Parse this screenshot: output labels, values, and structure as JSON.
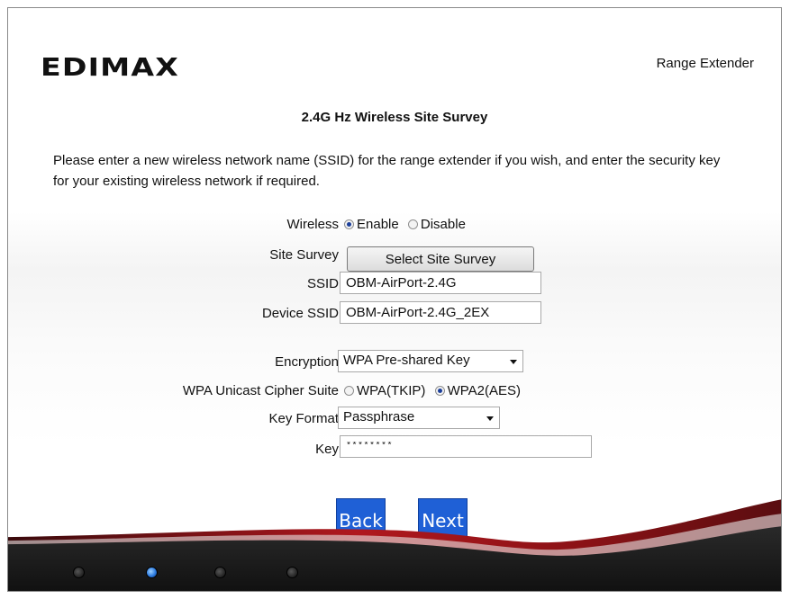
{
  "header": {
    "logo_text": "EDIMAX",
    "product": "Range Extender"
  },
  "page": {
    "title": "2.4G Hz  Wireless Site Survey",
    "description": "Please enter a new wireless network name (SSID) for the range extender if you wish, and enter the security key for your existing wireless network if required."
  },
  "form": {
    "wireless": {
      "label": "Wireless",
      "options": [
        "Enable",
        "Disable"
      ],
      "selected": "Enable"
    },
    "site_survey": {
      "label": "Site Survey",
      "button": "Select Site Survey"
    },
    "ssid": {
      "label": "SSID",
      "value": "OBM-AirPort-2.4G"
    },
    "device_ssid": {
      "label": "Device SSID",
      "value": "OBM-AirPort-2.4G_2EX"
    },
    "encryption": {
      "label": "Encryption",
      "value": "WPA Pre-shared Key"
    },
    "cipher": {
      "label": "WPA Unicast Cipher Suite",
      "options": [
        "WPA(TKIP)",
        "WPA2(AES)"
      ],
      "selected": "WPA2(AES)"
    },
    "key_format": {
      "label": "Key Format",
      "value": "Passphrase"
    },
    "key": {
      "label": "Key",
      "value": "********"
    }
  },
  "nav": {
    "back": "Back",
    "next": "Next"
  },
  "footer": {
    "steps": 4,
    "active_step": 2
  },
  "colors": {
    "accent": "#1f60d6",
    "swoosh": "#8b1418",
    "footer_bg": "#1b1b1b"
  }
}
